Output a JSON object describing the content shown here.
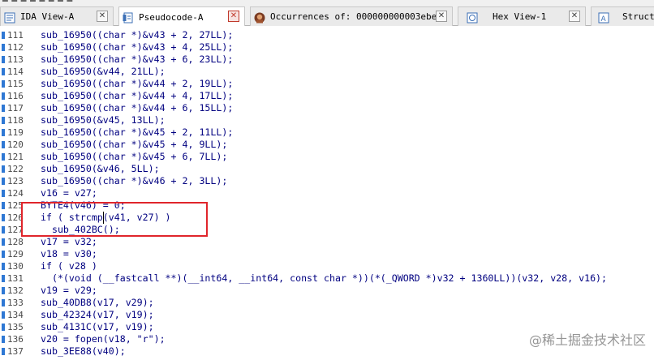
{
  "topstrip_text": "■ ■ ■ ■ ■ ■ ■ ■",
  "tabs": [
    {
      "label": "IDA View-A",
      "icon": "ida-view-icon",
      "active": false
    },
    {
      "label": "Pseudocode-A",
      "icon": "pseudocode-icon",
      "active": true
    },
    {
      "label": "Occurrences of: 000000000003ebe8",
      "icon": "occurrences-icon",
      "active": false
    },
    {
      "label": "Hex View-1",
      "icon": "hex-view-icon",
      "active": false
    },
    {
      "label": "Struct",
      "icon": "structures-icon",
      "active": false
    }
  ],
  "close_glyph": "✕",
  "code": [
    {
      "n": "111",
      "text": "sub_16950((char *)&v43 + 2, 27LL);"
    },
    {
      "n": "112",
      "text": "sub_16950((char *)&v43 + 4, 25LL);"
    },
    {
      "n": "113",
      "text": "sub_16950((char *)&v43 + 6, 23LL);"
    },
    {
      "n": "114",
      "text": "sub_16950(&v44, 21LL);"
    },
    {
      "n": "115",
      "text": "sub_16950((char *)&v44 + 2, 19LL);"
    },
    {
      "n": "116",
      "text": "sub_16950((char *)&v44 + 4, 17LL);"
    },
    {
      "n": "117",
      "text": "sub_16950((char *)&v44 + 6, 15LL);"
    },
    {
      "n": "118",
      "text": "sub_16950(&v45, 13LL);"
    },
    {
      "n": "119",
      "text": "sub_16950((char *)&v45 + 2, 11LL);"
    },
    {
      "n": "120",
      "text": "sub_16950((char *)&v45 + 4, 9LL);"
    },
    {
      "n": "121",
      "text": "sub_16950((char *)&v45 + 6, 7LL);"
    },
    {
      "n": "122",
      "text": "sub_16950(&v46, 5LL);"
    },
    {
      "n": "123",
      "text": "sub_16950((char *)&v46 + 2, 3LL);"
    },
    {
      "n": "124",
      "text": "v16 = v27;"
    },
    {
      "n": "125",
      "text": "BYTE4(v46) = 0;"
    },
    {
      "n": "126",
      "text": "if ( strcmp(v41, v27) )"
    },
    {
      "n": "127",
      "text": "  sub_402BC();"
    },
    {
      "n": "128",
      "text": "v17 = v32;"
    },
    {
      "n": "129",
      "text": "v18 = v30;"
    },
    {
      "n": "130",
      "text": "if ( v28 )"
    },
    {
      "n": "131",
      "text": "  (*(void (__fastcall **)(__int64, __int64, const char *))(*(_QWORD *)v32 + 1360LL))(v32, v28, v16);"
    },
    {
      "n": "132",
      "text": "v19 = v29;"
    },
    {
      "n": "133",
      "text": "sub_40DB8(v17, v29);"
    },
    {
      "n": "134",
      "text": "sub_42324(v17, v19);"
    },
    {
      "n": "135",
      "text": "sub_4131C(v17, v19);"
    },
    {
      "n": "136",
      "text": "v20 = fopen(v18, \"r\");"
    },
    {
      "n": "137",
      "text": "sub_3EE88(v40);"
    }
  ],
  "watermark": "@稀土掘金技术社区"
}
